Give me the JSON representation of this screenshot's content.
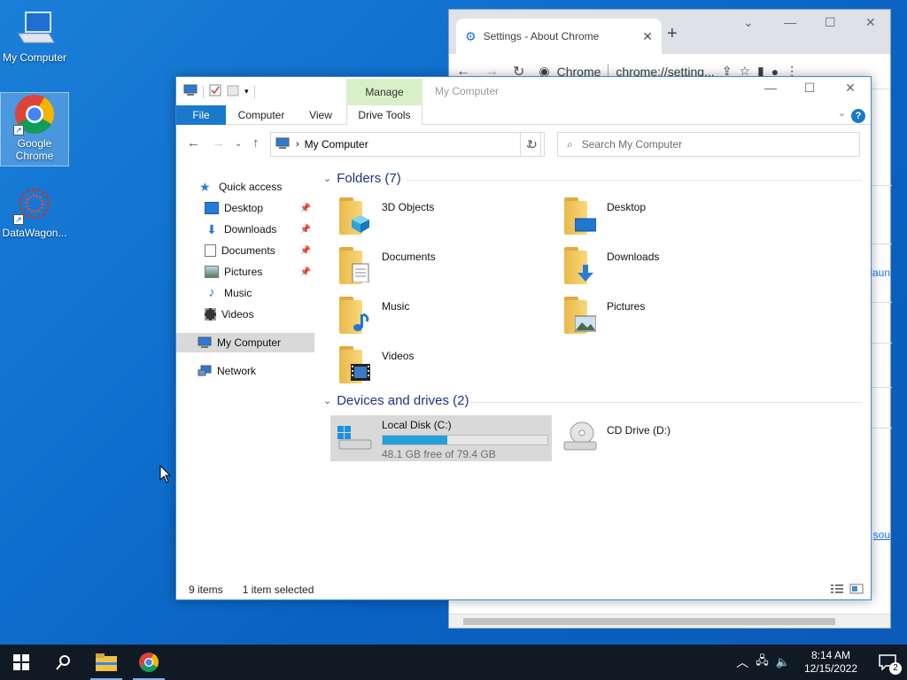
{
  "desktop": {
    "icons": [
      {
        "label": "My Computer"
      },
      {
        "label": "Google Chrome"
      },
      {
        "label": "DataWagon..."
      }
    ]
  },
  "chrome": {
    "tab_title": "Settings - About Chrome",
    "omnibox_site": "Chrome",
    "omnibox_url": "chrome://setting...",
    "side_text_1": "laun",
    "side_text_2": "sou"
  },
  "explorer": {
    "context_tab": "Manage",
    "title": "My Computer",
    "ribbon_tabs": [
      "File",
      "Computer",
      "View",
      "Drive Tools"
    ],
    "address": "My Computer",
    "search_placeholder": "Search My Computer",
    "nav": {
      "quick_access": "Quick access",
      "items": [
        "Desktop",
        "Downloads",
        "Documents",
        "Pictures",
        "Music",
        "Videos"
      ],
      "my_computer": "My Computer",
      "network": "Network"
    },
    "folders_header": "Folders (7)",
    "folders": [
      "3D Objects",
      "Desktop",
      "Documents",
      "Downloads",
      "Music",
      "Pictures",
      "Videos"
    ],
    "drives_header": "Devices and drives (2)",
    "drives": [
      {
        "name": "Local Disk (C:)",
        "free": "48.1 GB free of 79.4 GB",
        "used_fraction": 0.394
      },
      {
        "name": "CD Drive (D:)"
      }
    ],
    "status": {
      "items": "9 items",
      "selected": "1 item selected"
    }
  },
  "taskbar": {
    "time": "8:14 AM",
    "date": "12/15/2022",
    "notification_count": "2"
  },
  "colors": {
    "accent": "#1979ca",
    "manage_tab": "#d8f0c8",
    "progress": "#26a0da",
    "taskbar": "#101a24"
  }
}
